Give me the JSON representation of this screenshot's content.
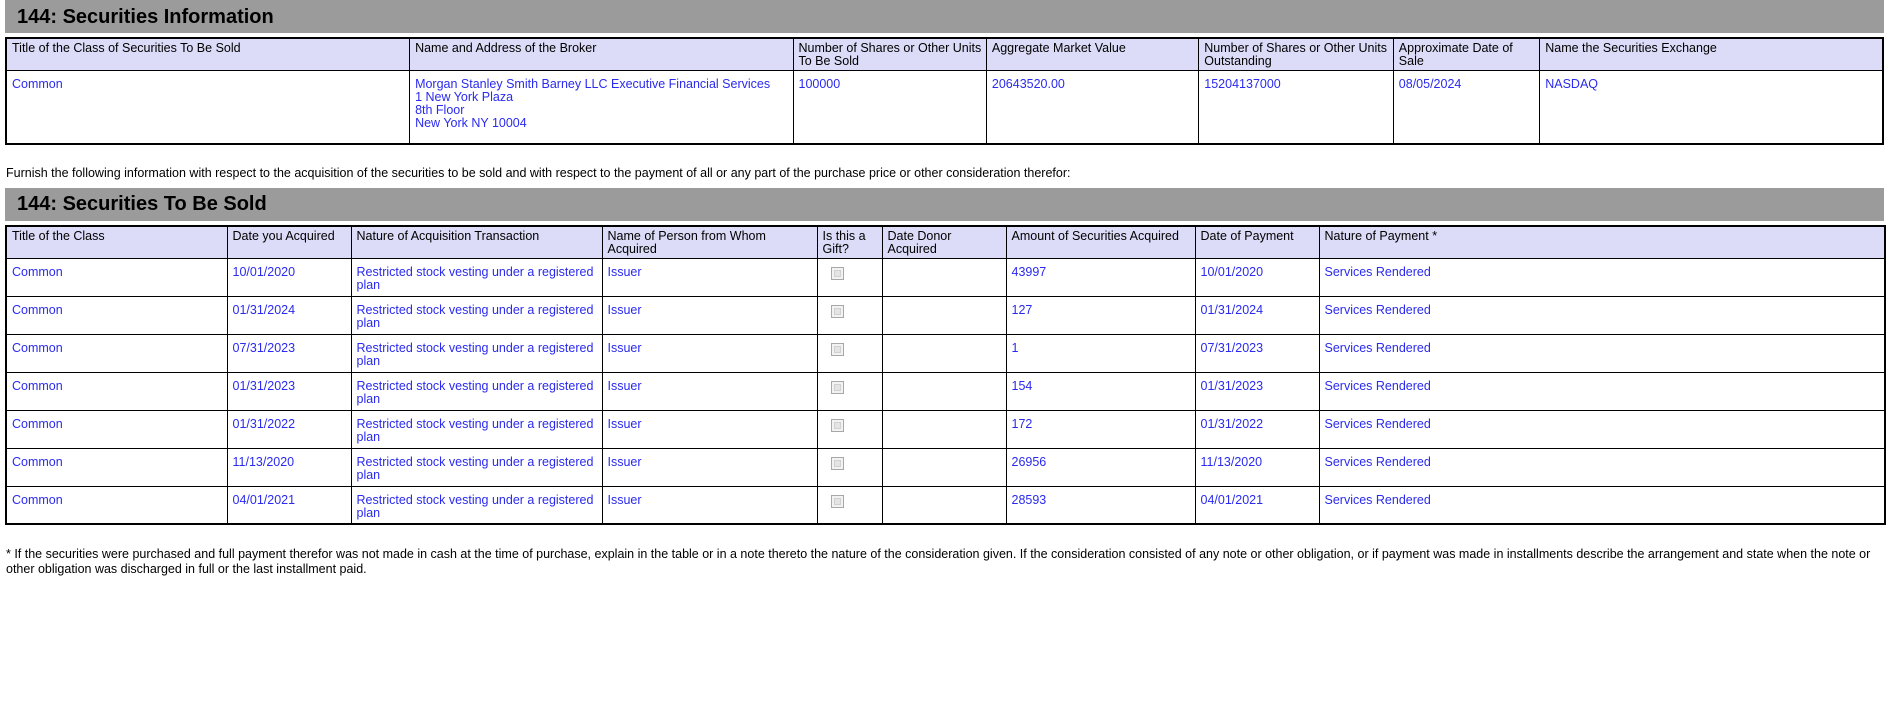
{
  "sections": {
    "securities_information": {
      "banner_title": "144: Securities Information",
      "columns": [
        "Title of the Class of Securities To Be Sold",
        "Name and Address of the Broker",
        "Number of Shares or Other Units To Be Sold",
        "Aggregate Market Value",
        "Number of Shares or Other Units Outstanding",
        "Approximate Date of Sale",
        "Name the Securities Exchange"
      ],
      "rows": [
        {
          "title_of_class": "Common",
          "broker_lines": [
            "Morgan Stanley Smith Barney LLC Executive Financial Services",
            "1 New York Plaza",
            "8th Floor",
            "New York   NY   10004"
          ],
          "units_to_be_sold": "100000",
          "aggregate_market_value": "20643520.00",
          "units_outstanding": "15204137000",
          "approximate_date_of_sale": "08/05/2024",
          "securities_exchange": "NASDAQ"
        }
      ]
    },
    "lead_paragraph": "Furnish the following information with respect to the acquisition of the securities to be sold and with respect to the payment of all or any part of the purchase price or other consideration therefor:",
    "securities_to_be_sold": {
      "banner_title": "144: Securities To Be Sold",
      "columns": [
        "Title of the Class",
        "Date you Acquired",
        "Nature of Acquisition Transaction",
        "Name of Person from Whom Acquired",
        "Is this a Gift?",
        "Date Donor Acquired",
        "Amount of Securities Acquired",
        "Date of Payment",
        "Nature of Payment *"
      ],
      "rows": [
        {
          "title_of_class": "Common",
          "date_acquired": "10/01/2020",
          "nature_of_acquisition": "Restricted stock vesting under a registered plan",
          "person_from_whom_acquired": "Issuer",
          "is_gift": false,
          "date_donor_acquired": "",
          "amount_acquired": "43997",
          "date_of_payment": "10/01/2020",
          "nature_of_payment": "Services Rendered"
        },
        {
          "title_of_class": "Common",
          "date_acquired": "01/31/2024",
          "nature_of_acquisition": "Restricted stock vesting under a registered plan",
          "person_from_whom_acquired": "Issuer",
          "is_gift": false,
          "date_donor_acquired": "",
          "amount_acquired": "127",
          "date_of_payment": "01/31/2024",
          "nature_of_payment": "Services Rendered"
        },
        {
          "title_of_class": "Common",
          "date_acquired": "07/31/2023",
          "nature_of_acquisition": "Restricted stock vesting under a registered plan",
          "person_from_whom_acquired": "Issuer",
          "is_gift": false,
          "date_donor_acquired": "",
          "amount_acquired": "1",
          "date_of_payment": "07/31/2023",
          "nature_of_payment": "Services Rendered"
        },
        {
          "title_of_class": "Common",
          "date_acquired": "01/31/2023",
          "nature_of_acquisition": "Restricted stock vesting under a registered plan",
          "person_from_whom_acquired": "Issuer",
          "is_gift": false,
          "date_donor_acquired": "",
          "amount_acquired": "154",
          "date_of_payment": "01/31/2023",
          "nature_of_payment": "Services Rendered"
        },
        {
          "title_of_class": "Common",
          "date_acquired": "01/31/2022",
          "nature_of_acquisition": "Restricted stock vesting under a registered plan",
          "person_from_whom_acquired": "Issuer",
          "is_gift": false,
          "date_donor_acquired": "",
          "amount_acquired": "172",
          "date_of_payment": "01/31/2022",
          "nature_of_payment": "Services Rendered"
        },
        {
          "title_of_class": "Common",
          "date_acquired": "11/13/2020",
          "nature_of_acquisition": "Restricted stock vesting under a registered plan",
          "person_from_whom_acquired": "Issuer",
          "is_gift": false,
          "date_donor_acquired": "",
          "amount_acquired": "26956",
          "date_of_payment": "11/13/2020",
          "nature_of_payment": "Services Rendered"
        },
        {
          "title_of_class": "Common",
          "date_acquired": "04/01/2021",
          "nature_of_acquisition": "Restricted stock vesting under a registered plan",
          "person_from_whom_acquired": "Issuer",
          "is_gift": false,
          "date_donor_acquired": "",
          "amount_acquired": "28593",
          "date_of_payment": "04/01/2021",
          "nature_of_payment": "Services Rendered"
        }
      ]
    },
    "footnote": "* If the securities were purchased and full payment therefor was not made in cash at the time of purchase, explain in the table or in a note thereto the nature of the consideration given. If the consideration consisted of any note or other obligation, or if payment was made in installments describe the arrangement and state when the note or other obligation was discharged in full or the last installment paid."
  },
  "colors": {
    "banner_background": "#9b9b9b",
    "header_cell_background": "#dcdcf8",
    "value_text": "#2a2af0",
    "border": "#000000"
  }
}
